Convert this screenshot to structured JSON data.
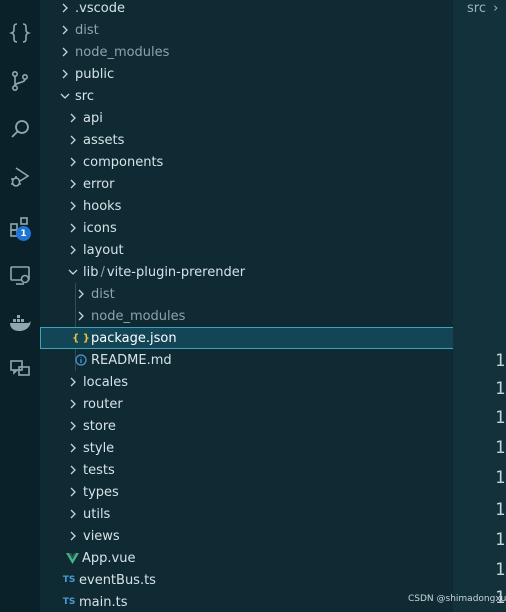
{
  "activity_bar": {
    "icons": [
      "braces-icon",
      "source-control-icon",
      "search-icon",
      "run-debug-icon",
      "extensions-icon",
      "remote-explorer-icon",
      "docker-icon",
      "comments-icon"
    ],
    "extensions_badge": "1"
  },
  "explorer": {
    "items": [
      {
        "label": ".vscode"
      },
      {
        "label": "dist"
      },
      {
        "label": "node_modules"
      },
      {
        "label": "public"
      },
      {
        "label": "src"
      },
      {
        "label": "api"
      },
      {
        "label": "assets"
      },
      {
        "label": "components"
      },
      {
        "label": "error"
      },
      {
        "label": "hooks"
      },
      {
        "label": "icons"
      },
      {
        "label": "layout"
      },
      {
        "label": "lib",
        "label_suffix": "vite-plugin-prerender"
      },
      {
        "label": "dist"
      },
      {
        "label": "node_modules"
      },
      {
        "label": "package.json",
        "icon_text": "{ }"
      },
      {
        "label": "README.md"
      },
      {
        "label": "locales"
      },
      {
        "label": "router"
      },
      {
        "label": "store"
      },
      {
        "label": "style"
      },
      {
        "label": "tests"
      },
      {
        "label": "types"
      },
      {
        "label": "utils"
      },
      {
        "label": "views"
      },
      {
        "label": "App.vue"
      },
      {
        "label": "eventBus.ts",
        "icon_text": "TS"
      },
      {
        "label": "main.ts",
        "icon_text": "TS"
      }
    ],
    "path_separator": "/"
  },
  "editor": {
    "breadcrumb": "src",
    "line_numbers": [
      "1",
      "1",
      "1",
      "1",
      "1",
      "1",
      "1",
      "1",
      "1"
    ]
  },
  "watermark": "CSDN @shimadongxue",
  "colors": {
    "sidebar_bg": "#0f2a33",
    "activity_bg": "#0b2129",
    "selection_bg": "#124556",
    "selection_border": "#3ea3b8",
    "badge": "#1f74d6",
    "vue_green": "#41b883",
    "ts_blue": "#4b9ad6",
    "json_yellow": "#e5c146"
  }
}
